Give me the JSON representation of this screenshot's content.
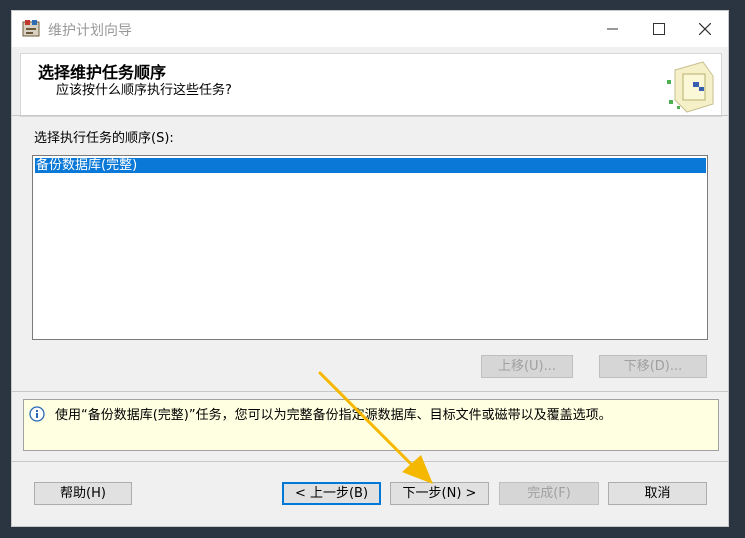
{
  "window": {
    "title": "维护计划向导"
  },
  "header": {
    "title": "选择维护任务顺序",
    "subtitle": "应该按什么顺序执行这些任务?"
  },
  "task_list": {
    "label": "选择执行任务的顺序(S):",
    "items": [
      "备份数据库(完整)"
    ],
    "selected_index": 0
  },
  "order_buttons": {
    "move_up": "上移(U)...",
    "move_down": "下移(D)..."
  },
  "info": {
    "text": "使用“备份数据库(完整)”任务，您可以为完整备份指定源数据库、目标文件或磁带以及覆盖选项。"
  },
  "footer": {
    "help": "帮助(H)",
    "back": "< 上一步(B)",
    "next": "下一步(N) >",
    "finish": "完成(F)",
    "cancel": "取消"
  },
  "colors": {
    "selection": "#0a78d7",
    "info_bg": "#ffffe1",
    "annotation_arrow": "#f5b800"
  }
}
